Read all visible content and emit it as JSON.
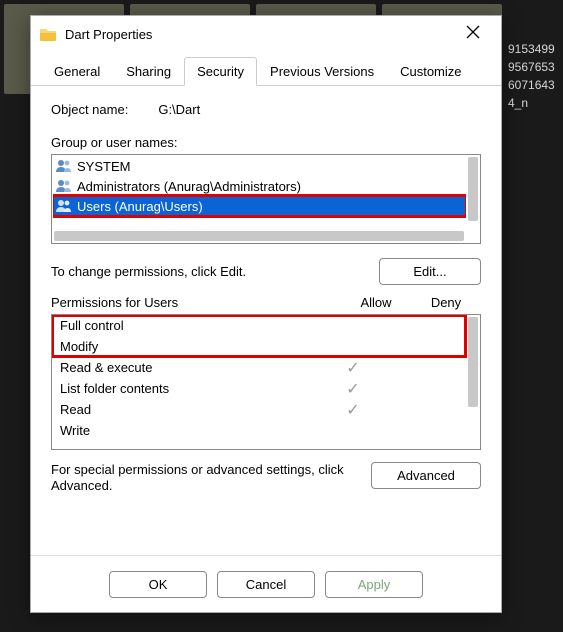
{
  "bg_right": [
    "9153499",
    "9567653",
    "6071643",
    "4_n"
  ],
  "title": "Dart Properties",
  "tabs": [
    "General",
    "Sharing",
    "Security",
    "Previous Versions",
    "Customize"
  ],
  "active_tab": "Security",
  "object_label": "Object name:",
  "object_value": "G:\\Dart",
  "group_label": "Group or user names:",
  "users": [
    {
      "label": "SYSTEM"
    },
    {
      "label": "Administrators (Anurag\\Administrators)"
    },
    {
      "label": "Users (Anurag\\Users)"
    }
  ],
  "change_hint": "To change permissions, click Edit.",
  "edit_btn": "Edit...",
  "perm_header": "Permissions for Users",
  "allow_label": "Allow",
  "deny_label": "Deny",
  "permissions": [
    {
      "name": "Full control",
      "allow": false
    },
    {
      "name": "Modify",
      "allow": false
    },
    {
      "name": "Read & execute",
      "allow": true
    },
    {
      "name": "List folder contents",
      "allow": true
    },
    {
      "name": "Read",
      "allow": true
    },
    {
      "name": "Write",
      "allow": false
    }
  ],
  "adv_text": "For special permissions or advanced settings, click Advanced.",
  "adv_btn": "Advanced",
  "ok_btn": "OK",
  "cancel_btn": "Cancel",
  "apply_btn": "Apply"
}
